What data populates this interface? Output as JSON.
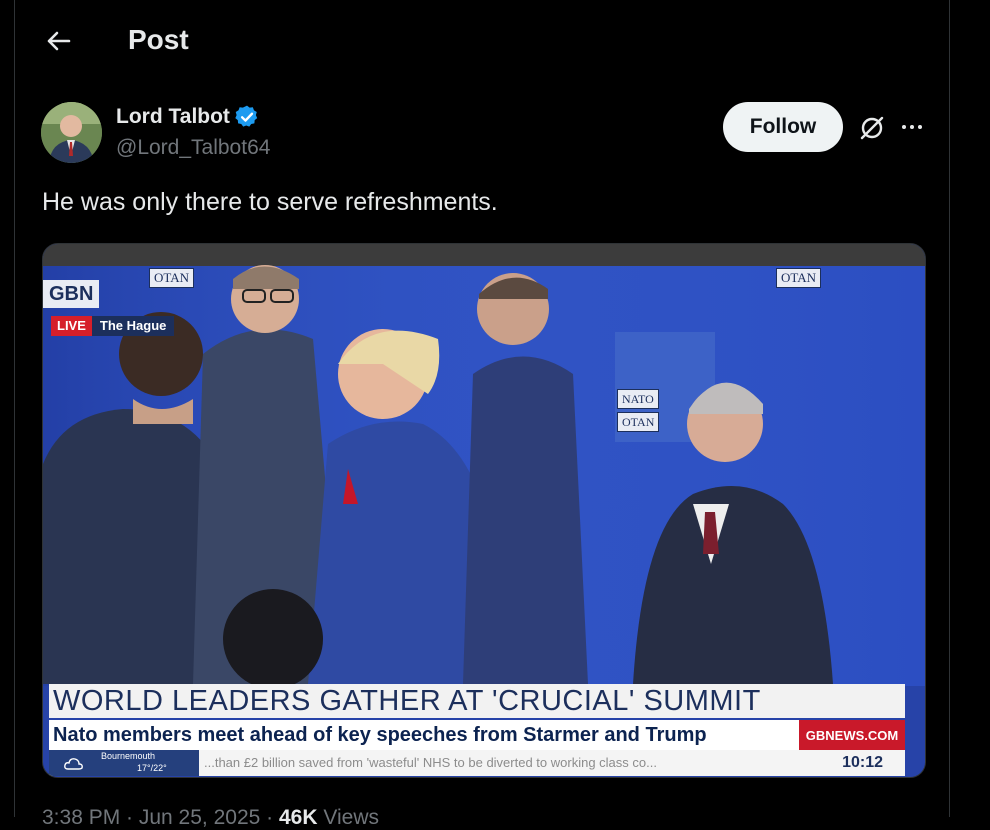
{
  "header": {
    "title": "Post"
  },
  "author": {
    "name": "Lord Talbot",
    "handle": "@Lord_Talbot64"
  },
  "actions": {
    "follow_label": "Follow"
  },
  "tweet": {
    "text": "He was only there to serve refreshments."
  },
  "media": {
    "live_label": "LIVE",
    "location": "The Hague",
    "logo_fragment": "GBN",
    "otan_label": "OTAN",
    "nato_label": "NATO",
    "headline": "WORLD LEADERS GATHER AT 'CRUCIAL' SUMMIT",
    "subheadline": "Nato members meet ahead of key speeches from Starmer and Trump",
    "brand": "GBNEWS.COM",
    "weather_place": "Bournemouth",
    "weather_temp": "17°/22°",
    "ticker": "...than £2 billion saved from 'wasteful' NHS to be diverted to working class co...",
    "clock": "10:12"
  },
  "meta": {
    "time": "3:38 PM · Jun 25, 2025 ·",
    "views": "46K",
    "views_label": "Views"
  },
  "colors": {
    "background": "#000000",
    "follow_bg": "#eff3f4",
    "verified": "#1d9bf0",
    "muted": "#71767b"
  }
}
